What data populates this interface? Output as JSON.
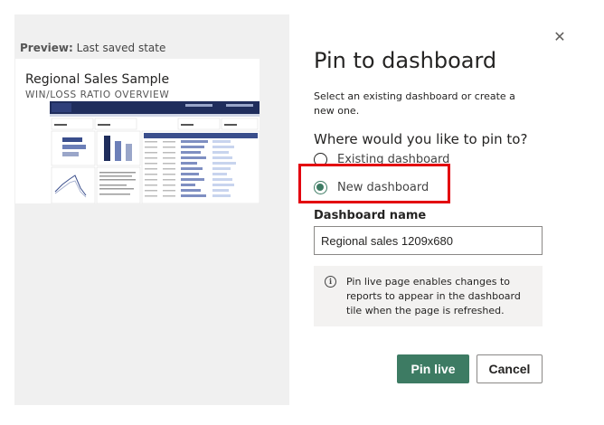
{
  "preview": {
    "label_prefix": "Preview:",
    "label_text": "Last saved state",
    "report_title": "Regional Sales Sample",
    "report_subtitle": "WIN/LOSS RATIO OVERVIEW"
  },
  "dialog": {
    "title": "Pin to dashboard",
    "description": "Select an existing dashboard or create a new one.",
    "question": "Where would you like to pin to?",
    "options": [
      {
        "label": "Existing dashboard",
        "selected": false
      },
      {
        "label": "New dashboard",
        "selected": true
      }
    ],
    "name_label": "Dashboard name",
    "name_value": "Regional sales 1209x680",
    "info_text": "Pin live page enables changes to reports to appear in the dashboard tile when the page is refreshed.",
    "pin_button": "Pin live",
    "cancel_button": "Cancel",
    "close_glyph": "✕"
  },
  "colors": {
    "accent": "#3d7b63",
    "highlight": "#e3000f",
    "report_header": "#1f2d5c",
    "bar_primary": "#3a4e8c",
    "bar_secondary": "#9aa6c9"
  }
}
